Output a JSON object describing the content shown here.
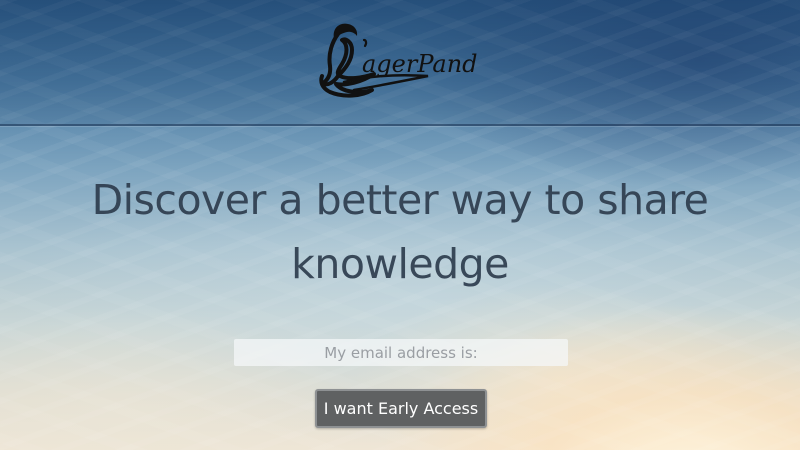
{
  "brand": {
    "logo_text": "LagerPanda",
    "logo_icon": "panda-ear-logo-icon"
  },
  "hero": {
    "headline_line1": "Discover a better way to share",
    "headline_line2": "knowledge"
  },
  "signup": {
    "email_placeholder": "My email address is:",
    "email_value": "",
    "button_label": "I want Early Access"
  },
  "colors": {
    "headline_text": "#2e3d4e",
    "button_bg": "#5f6162",
    "button_border": "#8e9193",
    "button_text": "#ffffff"
  }
}
